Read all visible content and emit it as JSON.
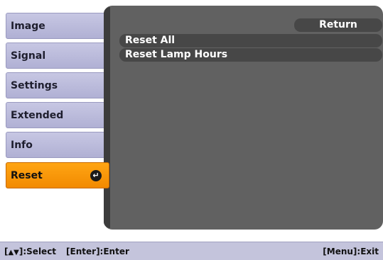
{
  "sidebar": {
    "items": [
      {
        "label": "Image"
      },
      {
        "label": "Signal"
      },
      {
        "label": "Settings"
      },
      {
        "label": "Extended"
      },
      {
        "label": "Info"
      },
      {
        "label": "Reset",
        "selected": true
      }
    ],
    "enter_icon": "enter-icon"
  },
  "submenu": {
    "return_label": "Return",
    "items": [
      {
        "label": "Reset All"
      },
      {
        "label": "Reset Lamp Hours"
      }
    ]
  },
  "footer": {
    "select_prefix": "[",
    "select_suffix": "]:Select",
    "updown_icon": "up-down-arrow-icon",
    "enter_hint": "[Enter]:Enter",
    "exit_hint": "[Menu]:Exit"
  },
  "colors": {
    "selected": "#f28a00",
    "menu_item": "#b8b8da",
    "panel": "#616161",
    "row": "#474747"
  }
}
